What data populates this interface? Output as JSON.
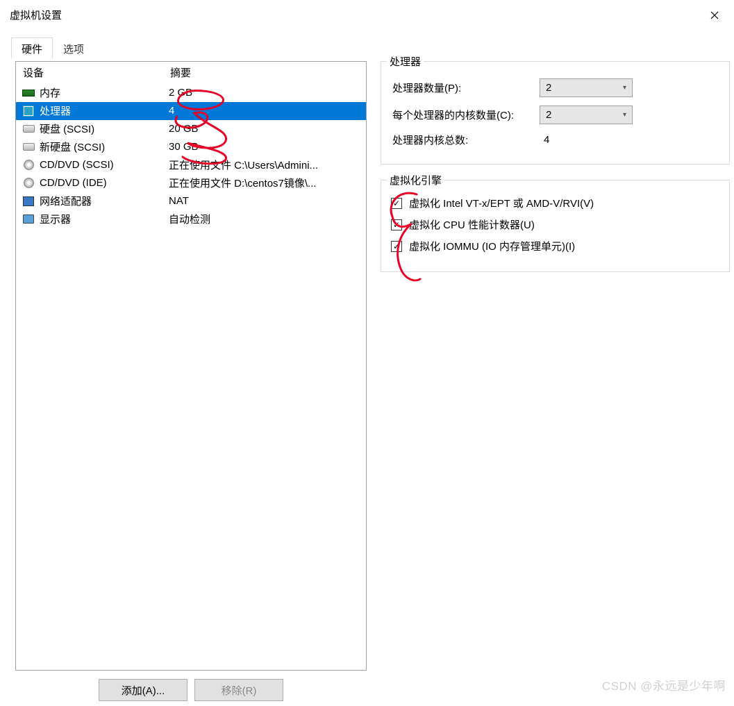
{
  "titlebar": {
    "title": "虚拟机设置"
  },
  "tabs": {
    "hardware": "硬件",
    "options": "选项"
  },
  "device_list": {
    "header_device": "设备",
    "header_summary": "摘要",
    "rows": [
      {
        "name": "内存",
        "summary": "2 GB",
        "icon": "ram"
      },
      {
        "name": "处理器",
        "summary": "4",
        "icon": "cpu",
        "selected": true
      },
      {
        "name": "硬盘 (SCSI)",
        "summary": "20 GB",
        "icon": "hdd"
      },
      {
        "name": "新硬盘 (SCSI)",
        "summary": "30 GB",
        "icon": "hdd"
      },
      {
        "name": "CD/DVD (SCSI)",
        "summary": "正在使用文件 C:\\Users\\Admini...",
        "icon": "cd"
      },
      {
        "name": "CD/DVD (IDE)",
        "summary": "正在使用文件 D:\\centos7镜像\\...",
        "icon": "cd"
      },
      {
        "name": "网络适配器",
        "summary": "NAT",
        "icon": "net"
      },
      {
        "name": "显示器",
        "summary": "自动检测",
        "icon": "disp"
      }
    ]
  },
  "buttons": {
    "add": "添加(A)...",
    "remove": "移除(R)"
  },
  "processor_panel": {
    "legend": "处理器",
    "count_label": "处理器数量(P):",
    "count_value": "2",
    "cores_label": "每个处理器的内核数量(C):",
    "cores_value": "2",
    "total_label": "处理器内核总数:",
    "total_value": "4"
  },
  "virt_panel": {
    "legend": "虚拟化引擎",
    "cb1": "虚拟化 Intel VT-x/EPT 或 AMD-V/RVI(V)",
    "cb2": "虚拟化 CPU 性能计数器(U)",
    "cb3": "虚拟化 IOMMU (IO 内存管理单元)(I)"
  },
  "watermark": "CSDN @永远是少年啊"
}
